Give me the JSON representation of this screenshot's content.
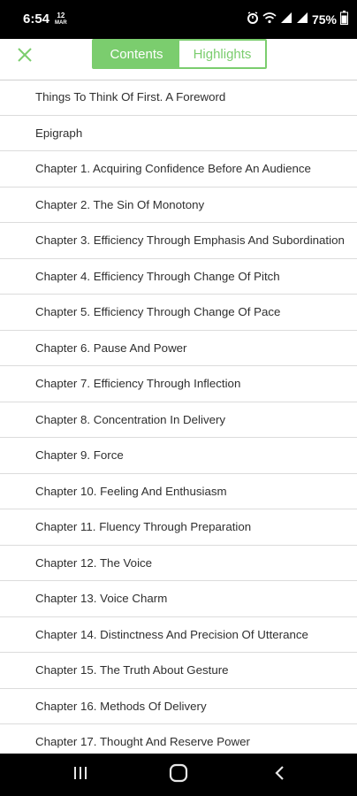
{
  "status_bar": {
    "time": "6:54",
    "date_top": "12",
    "date_bottom": "MAR",
    "battery": "75%",
    "icons": [
      "alarm-icon",
      "wifi-icon",
      "signal-icon",
      "signal-icon",
      "battery-icon"
    ]
  },
  "header": {
    "close_icon": "close-icon",
    "tabs": [
      {
        "label": "Contents",
        "active": true
      },
      {
        "label": "Highlights",
        "active": false
      }
    ]
  },
  "contents": [
    "Things To Think Of First. A Foreword",
    "Epigraph",
    "Chapter 1. Acquiring Confidence Before An Audience",
    "Chapter 2. The Sin Of Monotony",
    "Chapter 3. Efficiency Through Emphasis And Subordination",
    "Chapter 4. Efficiency Through Change Of Pitch",
    "Chapter 5. Efficiency Through Change Of Pace",
    "Chapter 6. Pause And Power",
    "Chapter 7. Efficiency Through Inflection",
    "Chapter 8. Concentration In Delivery",
    "Chapter 9. Force",
    "Chapter 10. Feeling And Enthusiasm",
    "Chapter 11. Fluency Through Preparation",
    "Chapter 12. The Voice",
    "Chapter 13. Voice Charm",
    "Chapter 14. Distinctness And Precision Of Utterance",
    "Chapter 15. The Truth About Gesture",
    "Chapter 16. Methods Of Delivery",
    "Chapter 17. Thought And Reserve Power"
  ],
  "nav_bar": {
    "icons": [
      "recent-apps-icon",
      "home-icon",
      "back-icon"
    ]
  },
  "colors": {
    "accent": "#7bcd6e",
    "divider": "#dcdcdc",
    "text": "#2f2f2f"
  }
}
